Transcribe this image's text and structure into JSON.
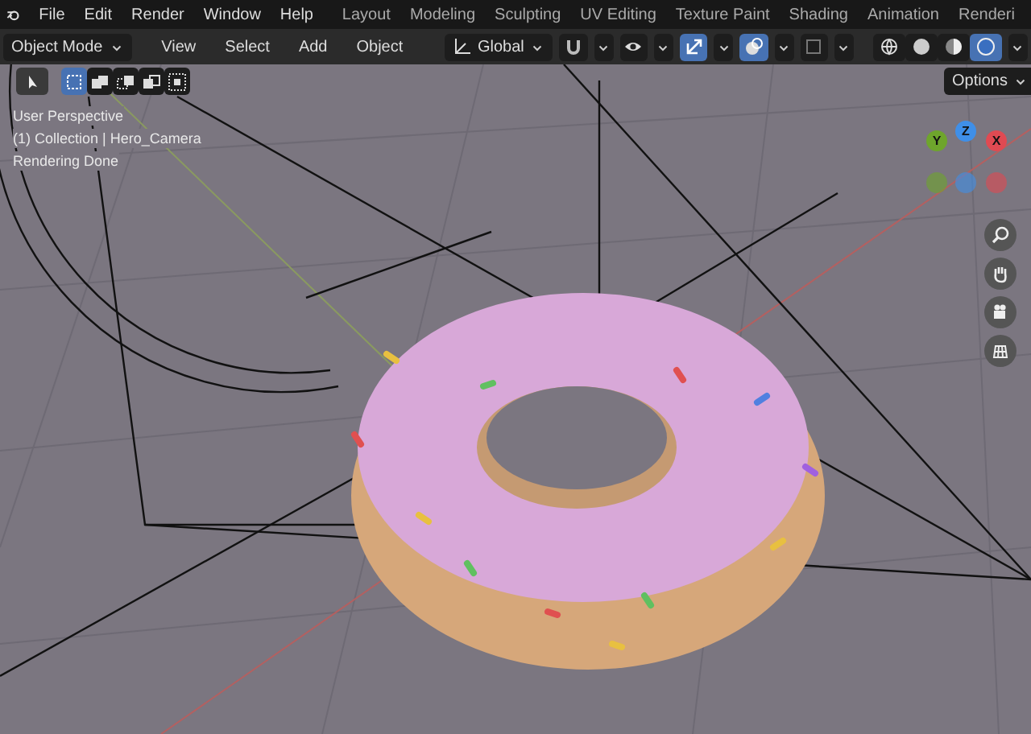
{
  "menu": [
    "File",
    "Edit",
    "Render",
    "Window",
    "Help"
  ],
  "workspaces": [
    "Layout",
    "Modeling",
    "Sculpting",
    "UV Editing",
    "Texture Paint",
    "Shading",
    "Animation",
    "Renderi"
  ],
  "header": {
    "mode": "Object Mode",
    "menus": [
      "View",
      "Select",
      "Add",
      "Object"
    ],
    "orientation": "Global"
  },
  "toggles": [
    {
      "kind": "snap",
      "on": false
    },
    {
      "kind": "visibility",
      "on": false
    },
    {
      "kind": "gizmo",
      "on": true
    },
    {
      "kind": "overlay",
      "on": true
    },
    {
      "kind": "xray",
      "on": false
    }
  ],
  "shading": [
    {
      "kind": "wireframe",
      "selected": false
    },
    {
      "kind": "solid",
      "selected": false
    },
    {
      "kind": "material",
      "selected": false
    },
    {
      "kind": "rendered",
      "selected": true
    }
  ],
  "select_modes": [
    {
      "kind": "set",
      "selected": true
    },
    {
      "kind": "extend",
      "selected": false
    },
    {
      "kind": "subtract",
      "selected": false
    },
    {
      "kind": "invert",
      "selected": false
    },
    {
      "kind": "intersect",
      "selected": false
    }
  ],
  "options": "Options",
  "overlay_text": [
    "User Perspective",
    "(1) Collection | Hero_Camera",
    "Rendering Done"
  ],
  "gizmo": [
    {
      "label": "Y",
      "color": "#6ea52c"
    },
    {
      "label": "Z",
      "color": "#3f8fe8"
    },
    {
      "label": "X",
      "color": "#e04a52"
    }
  ],
  "nav_buttons": [
    {
      "kind": "zoom"
    },
    {
      "kind": "pan"
    },
    {
      "kind": "camera"
    },
    {
      "kind": "grid"
    }
  ]
}
